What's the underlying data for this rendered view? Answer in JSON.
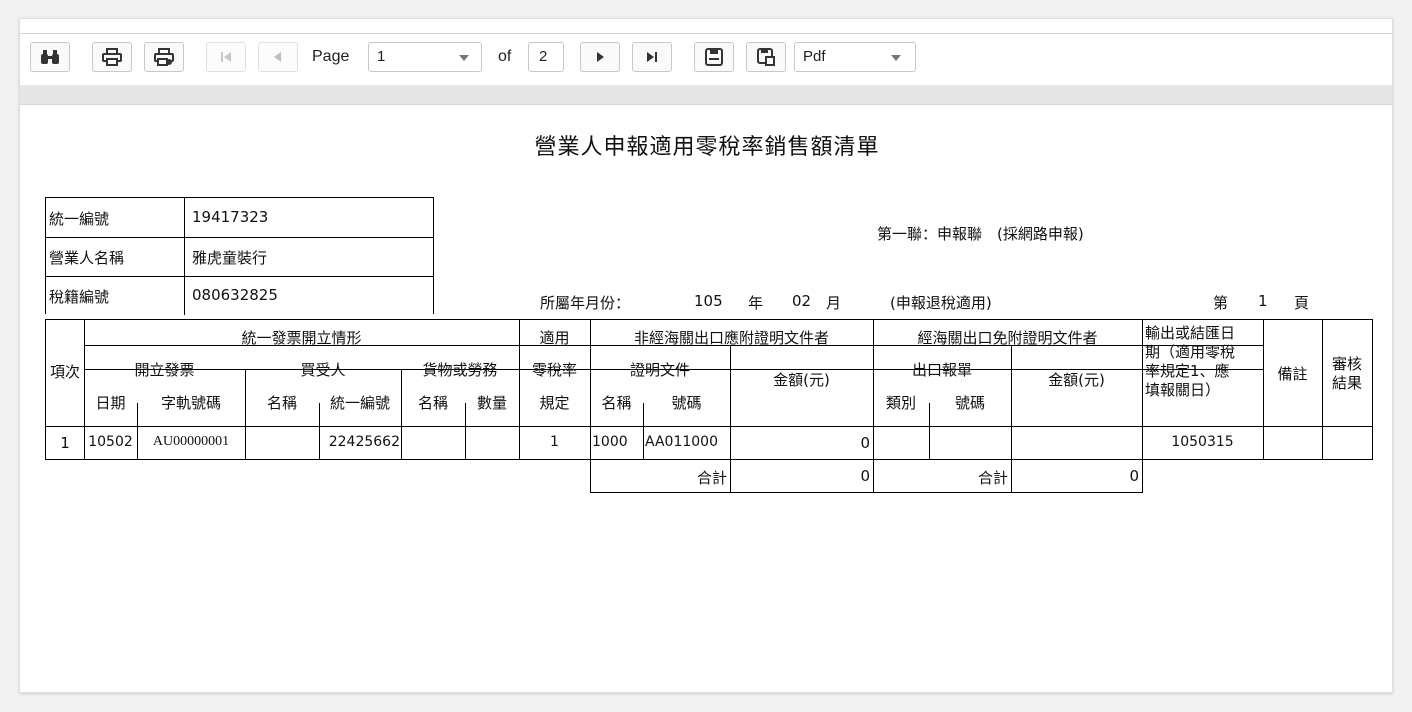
{
  "toolbar": {
    "page_label": "Page",
    "page_value": "1",
    "of_label": "of",
    "total_pages": "2",
    "export_format": "Pdf"
  },
  "report": {
    "title": "營業人申報適用零稅率銷售額清單",
    "copy_note": "第一聯：申報聯　(採網路申報)",
    "period_label": "所屬年月份：",
    "year": "105",
    "year_unit": "年",
    "month": "02",
    "month_unit": "月",
    "refund_note": "(申報退稅適用)",
    "page_prefix": "第",
    "page_no": "1",
    "page_suffix": "頁"
  },
  "info": {
    "rows": [
      {
        "label": "統一編號",
        "value": "19417323"
      },
      {
        "label": "營業人名稱",
        "value": "雅虎童裝行"
      },
      {
        "label": "稅籍編號",
        "value": "080632825"
      }
    ]
  },
  "table": {
    "h_item": "項次",
    "h_invoice_group": "統一發票開立情形",
    "h_issue": "開立發票",
    "h_buyer": "買受人",
    "h_goods": "貨物或勞務",
    "h_date": "日期",
    "h_track": "字軌號碼",
    "h_buyer_name": "名稱",
    "h_buyer_ban": "統一編號",
    "h_goods_name": "名稱",
    "h_qty": "數量",
    "h_zero1": "適用",
    "h_zero2": "零稅率",
    "h_zero3": "規定",
    "h_nonc_group": "非經海關出口應附證明文件者",
    "h_proof": "證明文件",
    "h_proof_name": "名稱",
    "h_proof_no": "號碼",
    "h_amount1": "金額(元)",
    "h_cust_group": "經海關出口免附證明文件者",
    "h_export_decl": "出口報單",
    "h_decl_type": "類別",
    "h_decl_no": "號碼",
    "h_amount2": "金額(元)",
    "h_exp_date1": "輸出或結匯日",
    "h_exp_date2": "期（適用零稅",
    "h_exp_date3": "率規定1、應",
    "h_exp_date4": "填報關日）",
    "h_remark": "備註",
    "h_audit1": "審核",
    "h_audit2": "結果",
    "row": {
      "item": "1",
      "date": "10502",
      "track": "AU00000001",
      "buyer_name": "",
      "buyer_ban": "22425662",
      "goods_name": "",
      "qty": "",
      "zero_rule": "1",
      "proof_name": "1000",
      "proof_no": "AA011000",
      "amount1": "0",
      "decl_type": "",
      "decl_no": "",
      "amount2": "",
      "export_date": "1050315",
      "remark": "",
      "audit": ""
    },
    "total_label1": "合計",
    "total_value1": "0",
    "total_label2": "合計",
    "total_value2": "0"
  }
}
